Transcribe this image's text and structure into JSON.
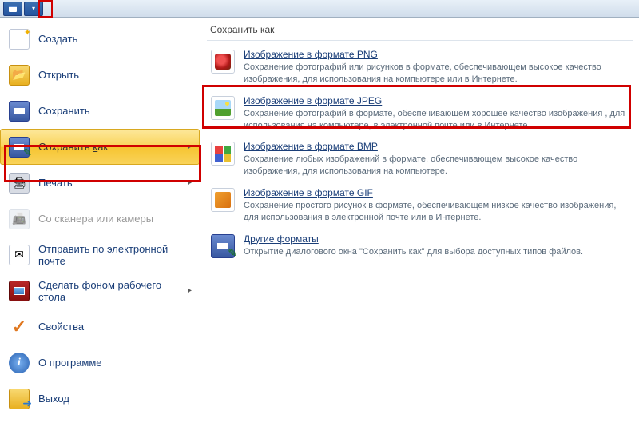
{
  "titlebar": {
    "items": [
      "app",
      "dropdown"
    ]
  },
  "sidebar": {
    "items": [
      {
        "label": "Создать",
        "visibleLabel": "Создать",
        "disabled": false,
        "arrow": false
      },
      {
        "label": "Открыть",
        "visibleLabel": "Открыть",
        "disabled": false,
        "arrow": false
      },
      {
        "label": "Сохранить",
        "visibleLabel": "Сохранить",
        "disabled": false,
        "arrow": false
      },
      {
        "label": "Сохранить как",
        "visibleLabel": "Сохранить как",
        "disabled": false,
        "arrow": true,
        "selected": true
      },
      {
        "label": "Печать",
        "visibleLabel": "Печать",
        "disabled": false,
        "arrow": true
      },
      {
        "label": "Со сканера или камеры",
        "visibleLabel": "Со сканера или камеры",
        "disabled": true,
        "arrow": false
      },
      {
        "label": "Отправить по электронной почте",
        "visibleLabel": "Отправить по электронной почте",
        "disabled": false,
        "arrow": false
      },
      {
        "label": "Сделать фоном рабочего стола",
        "visibleLabel": "Сделать фоном рабочего стола",
        "disabled": false,
        "arrow": true
      },
      {
        "label": "Свойства",
        "visibleLabel": "Свойства",
        "disabled": false,
        "arrow": false
      },
      {
        "label": "О программе",
        "visibleLabel": "О программе",
        "disabled": false,
        "arrow": false
      },
      {
        "label": "Выход",
        "visibleLabel": "Выход",
        "disabled": false,
        "arrow": false
      }
    ]
  },
  "content": {
    "header": "Сохранить как",
    "formats": [
      {
        "title": "Изображение в формате PNG",
        "desc": "Сохранение фотографий или рисунков в формате, обеспечивающем высокое качество изображения, для использования на компьютере или в Интернете."
      },
      {
        "title": "Изображение в формате JPEG",
        "desc": "Сохранение фотографий в формате, обеспечивающем хорошее качество изображения , для использования на компьютере, в электронной почте или в Интернете."
      },
      {
        "title": "Изображение в формате BMP",
        "desc": "Сохранение любых изображений в формате, обеспечивающем высокое качество изображения, для использования на компьютере."
      },
      {
        "title": "Изображение в формате GIF",
        "desc": "Сохранение простого рисунок в формате, обеспечивающем низкое качество изображения, для использования в электронной почте или в Интернете."
      },
      {
        "title": "Другие форматы",
        "desc": "Открытие диалогового окна \"Сохранить как\" для выбора доступных типов файлов."
      }
    ]
  }
}
